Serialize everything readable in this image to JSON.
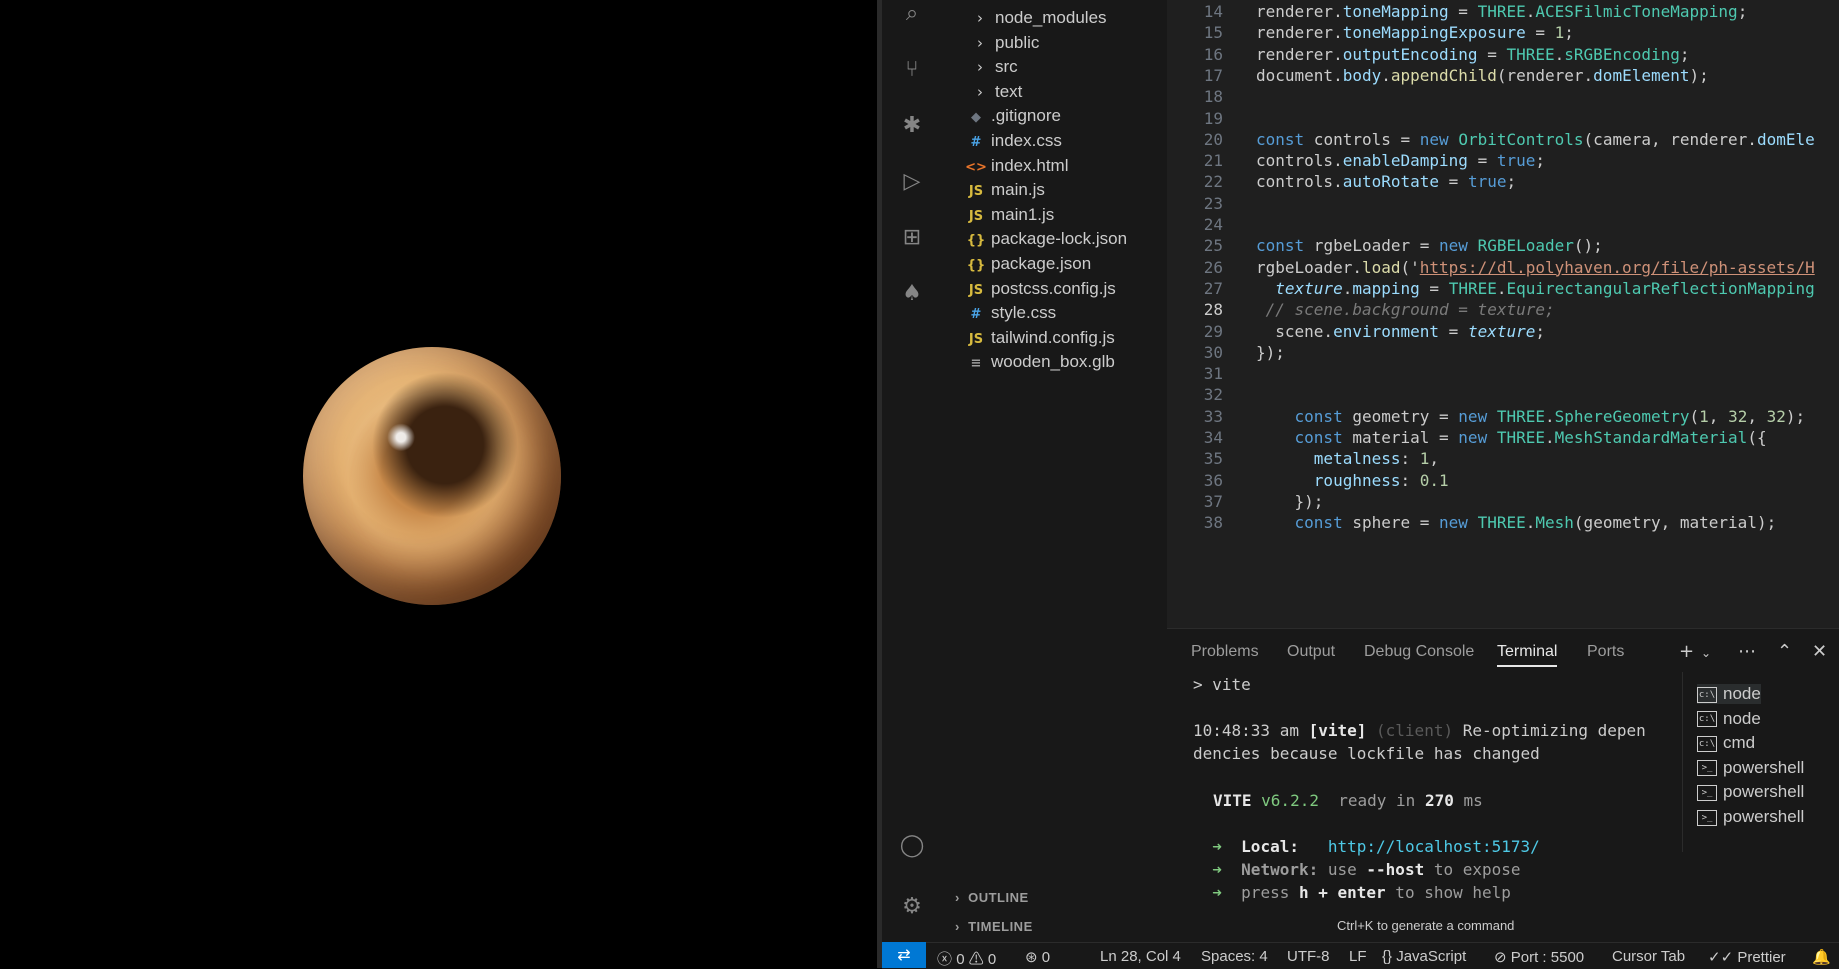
{
  "explorer": {
    "items": [
      {
        "type": "folder",
        "icon": "chevron-right",
        "glyph": "›",
        "label": "node_modules"
      },
      {
        "type": "folder",
        "icon": "chevron-right",
        "glyph": "›",
        "label": "public"
      },
      {
        "type": "folder",
        "icon": "chevron-right",
        "glyph": "›",
        "label": "src"
      },
      {
        "type": "folder",
        "icon": "chevron-right",
        "glyph": "›",
        "label": "text"
      },
      {
        "type": "git",
        "icon": "git-icon",
        "glyph": "◆",
        "label": ".gitignore"
      },
      {
        "type": "css",
        "icon": "css-icon",
        "glyph": "#",
        "label": "index.css"
      },
      {
        "type": "html",
        "icon": "html-icon",
        "glyph": "<>",
        "label": "index.html"
      },
      {
        "type": "js",
        "icon": "js-icon",
        "glyph": "JS",
        "label": "main.js"
      },
      {
        "type": "js",
        "icon": "js-icon",
        "glyph": "JS",
        "label": "main1.js"
      },
      {
        "type": "json",
        "icon": "json-icon",
        "glyph": "{}",
        "label": "package-lock.json"
      },
      {
        "type": "json",
        "icon": "json-icon",
        "glyph": "{}",
        "label": "package.json"
      },
      {
        "type": "js",
        "icon": "js-icon",
        "glyph": "JS",
        "label": "postcss.config.js"
      },
      {
        "type": "css",
        "icon": "css-icon",
        "glyph": "#",
        "label": "style.css"
      },
      {
        "type": "js",
        "icon": "js-icon",
        "glyph": "JS",
        "label": "tailwind.config.js"
      },
      {
        "type": "file",
        "icon": "file-icon",
        "glyph": "≡",
        "label": "wooden_box.glb"
      }
    ],
    "outline": "OUTLINE",
    "timeline": "TIMELINE"
  },
  "editor": {
    "active_line": 28,
    "lines": [
      {
        "n": "14",
        "code": "renderer.toneMapping = THREE.ACESFilmicToneMapping;"
      },
      {
        "n": "15",
        "code": "renderer.toneMappingExposure = 1;"
      },
      {
        "n": "16",
        "code": "renderer.outputEncoding = THREE.sRGBEncoding;"
      },
      {
        "n": "17",
        "code": "document.body.appendChild(renderer.domElement);"
      },
      {
        "n": "18",
        "code": ""
      },
      {
        "n": "19",
        "code": ""
      },
      {
        "n": "20",
        "code": "const controls = new OrbitControls(camera, renderer.domEle"
      },
      {
        "n": "21",
        "code": "controls.enableDamping = true;"
      },
      {
        "n": "22",
        "code": "controls.autoRotate = true;"
      },
      {
        "n": "23",
        "code": ""
      },
      {
        "n": "24",
        "code": ""
      },
      {
        "n": "25",
        "code": "const rgbeLoader = new RGBELoader();"
      },
      {
        "n": "26",
        "code": "rgbeLoader.load('https://dl.polyhaven.org/file/ph-assets/H"
      },
      {
        "n": "27",
        "code": "  texture.mapping = THREE.EquirectangularReflectionMapping"
      },
      {
        "n": "28",
        "code": " // scene.background = texture;"
      },
      {
        "n": "29",
        "code": "  scene.environment = texture;"
      },
      {
        "n": "30",
        "code": "});"
      },
      {
        "n": "31",
        "code": ""
      },
      {
        "n": "32",
        "code": ""
      },
      {
        "n": "33",
        "code": "    const geometry = new THREE.SphereGeometry(1, 32, 32);"
      },
      {
        "n": "34",
        "code": "    const material = new THREE.MeshStandardMaterial({"
      },
      {
        "n": "35",
        "code": "      metalness: 1,"
      },
      {
        "n": "36",
        "code": "      roughness: 0.1"
      },
      {
        "n": "37",
        "code": "    });"
      },
      {
        "n": "38",
        "code": "    const sphere = new THREE.Mesh(geometry, material);"
      }
    ]
  },
  "panel": {
    "tabs": [
      "Problems",
      "Output",
      "Debug Console",
      "Terminal",
      "Ports"
    ],
    "active_tab": "Terminal",
    "terminal_lines": {
      "l1": "> vite",
      "l2_time": "10:48:33 am ",
      "l2_tag": "[vite]",
      "l2_client": " (client)",
      "l2_msg": " Re-optimizing depen",
      "l3": "dencies because lockfile has changed",
      "vite_name": "VITE",
      "vite_ver": " v6.2.2",
      "ready": "  ready in ",
      "ready_ms": "270",
      "ready_unit": " ms",
      "local_label": "Local:",
      "local_url": "http://localhost:5173/",
      "network_label": "Network:",
      "network_msg": " use ",
      "network_flag": "--host",
      "network_tail": " to expose",
      "press": "press ",
      "press_key": "h + enter",
      "press_tail": " to show help"
    },
    "terminals": [
      "node",
      "node",
      "cmd",
      "powershell",
      "powershell",
      "powershell"
    ],
    "hint": "Ctrl+K to generate a command"
  },
  "status": {
    "errors": "0",
    "warnings": "0",
    "ports_count": "0",
    "position": "Ln 28, Col 4",
    "spaces": "Spaces: 4",
    "encoding": "UTF-8",
    "eol": "LF",
    "language": "JavaScript",
    "port": "Port : 5500",
    "cursor_tab": "Cursor Tab",
    "prettier": "Prettier"
  },
  "colors": {
    "accent": "#0078d4",
    "background": "#181818",
    "editor_bg": "#1f1f1f"
  }
}
